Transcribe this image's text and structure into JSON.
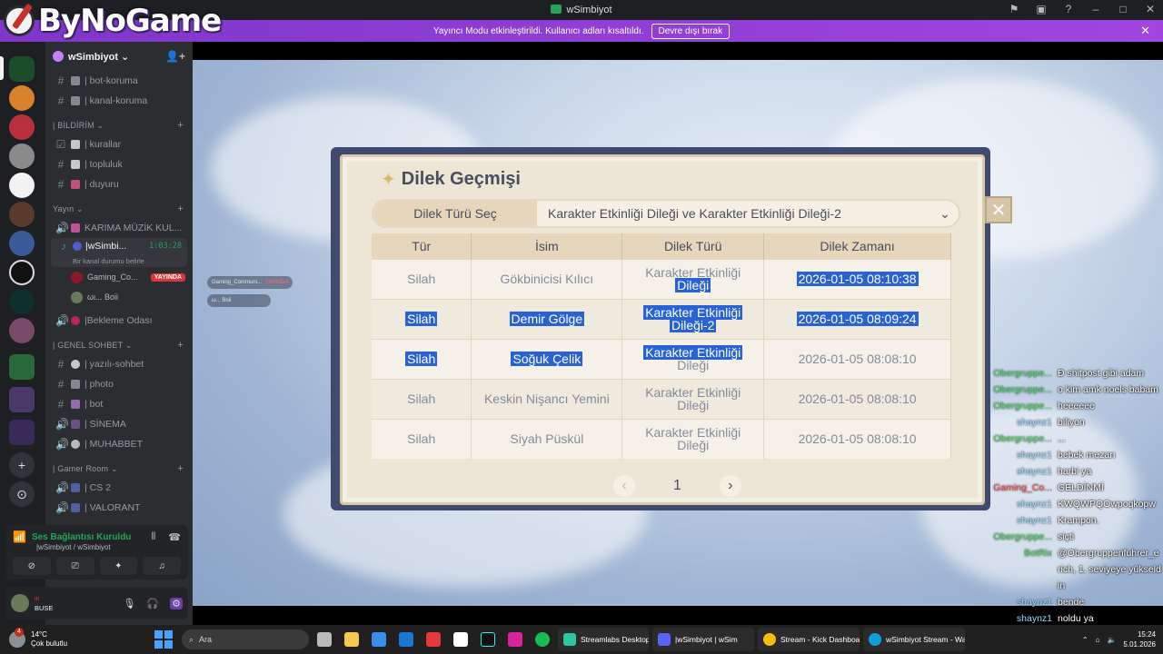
{
  "window": {
    "title": "wSimbiyot"
  },
  "brand": {
    "logo_text": "ByNoGame"
  },
  "banner": {
    "text": "Yayıncı Modu etkinleştirildi. Kullanıcı adları kısaltıldı.",
    "button": "Devre dışı bırak"
  },
  "server": {
    "name": "wSimbiyot ⌄"
  },
  "channels": {
    "top": [
      {
        "label": "| bot-koruma"
      },
      {
        "label": "| kanal-koruma"
      }
    ],
    "cat_bildirim": "| BİLDİRİM ⌄",
    "bildirim": [
      {
        "label": "| kurallar"
      },
      {
        "label": "| topluluk"
      },
      {
        "label": "| duyuru"
      }
    ],
    "cat_yayin": "Yayın ⌄",
    "yayin": [
      {
        "label": "KARIMA MÜZİK KUL..."
      }
    ],
    "active_voice": {
      "label": "|wSimbi...",
      "timer": "1:03:28",
      "status": "Bir kanal durumu belirle"
    },
    "voice_users": [
      {
        "name": "Gaming_Co...",
        "badge": "YAYINDA"
      },
      {
        "name": "ωι...  Boii"
      }
    ],
    "waiting": "|Bekleme Odası",
    "cat_genel": "| GENEL SOHBET ⌄",
    "genel": [
      {
        "label": "| yazılı-sohbet"
      },
      {
        "label": "| photo"
      },
      {
        "label": "| bot"
      },
      {
        "label": "| SİNEMA"
      },
      {
        "label": "| MUHABBET"
      }
    ],
    "cat_gamer": "| Gamer Room ⌄",
    "gamer": [
      {
        "label": "| CS 2"
      },
      {
        "label": "| VALORANT"
      }
    ]
  },
  "voice_panel": {
    "title": "Ses Bağlantısı Kuruldu",
    "sub": "|wSimbiyot / wSimbiyot"
  },
  "user_panel": {
    "name": "BUSE",
    "badge": "ιιι"
  },
  "stream_overlay": {
    "chip1": "Gaming_Communi...",
    "chip1_tag": "YAYINDA",
    "chip2": "ω...  Boii"
  },
  "wish": {
    "title": "Dilek Geçmişi",
    "select_label": "Dilek Türü Seç",
    "select_value": "Karakter Etkinliği Dileği ve Karakter Etkinliği Dileği-2",
    "headers": [
      "Tür",
      "İsim",
      "Dilek Türü",
      "Dilek Zamanı"
    ],
    "rows": [
      {
        "type": "Silah",
        "name": "Gökbinicisi Kılıcı",
        "wish1": "Karakter Etkinliği",
        "wish2": "Dileği",
        "time": "2026-01-05 08:10:38"
      },
      {
        "type": "Silah",
        "name": "Demir Gölge",
        "wish1": "Karakter Etkinliği",
        "wish2": "Dileği-2",
        "time": "2026-01-05 08:09:24"
      },
      {
        "type": "Silah",
        "name": "Soğuk Çelik",
        "wish1": "Karakter Etkinliği",
        "wish2": "Dileği",
        "time": "2026-01-05 08:08:10"
      },
      {
        "type": "Silah",
        "name": "Keskin Nişancı Yemini",
        "wish1": "Karakter Etkinliği",
        "wish2": "Dileği",
        "time": "2026-01-05 08:08:10"
      },
      {
        "type": "Silah",
        "name": "Siyah Püskül",
        "wish1": "Karakter Etkinliği",
        "wish2": "Dileği",
        "time": "2026-01-05 08:08:10"
      }
    ],
    "page": "1"
  },
  "chat": [
    {
      "user": "Obergruppe...",
      "text": "Đ shitpost gibi adam",
      "color": "#4cd964"
    },
    {
      "user": "Obergruppe...",
      "text": "o kim amk noels babam",
      "color": "#4cd964"
    },
    {
      "user": "Obergruppe...",
      "text": "heeeeee",
      "color": "#4cd964"
    },
    {
      "user": "shaynz1",
      "text": "biliyon",
      "color": "#9fd9ff"
    },
    {
      "user": "Obergruppe...",
      "text": "...",
      "color": "#4cd964"
    },
    {
      "user": "shaynz1",
      "text": "bebek mezarı",
      "color": "#9fd9ff"
    },
    {
      "user": "shaynz1",
      "text": "harbi ya",
      "color": "#9fd9ff"
    },
    {
      "user": "Gaming_Co...",
      "text": "GELDİNMİ",
      "color": "#ff4d4d"
    },
    {
      "user": "shaynz1",
      "text": "KWQWPQOwpoqkopw",
      "color": "#9fd9ff"
    },
    {
      "user": "shaynz1",
      "text": "Krampon.",
      "color": "#9fd9ff"
    },
    {
      "user": "Obergruppe...",
      "text": "siçti",
      "color": "#4cd964"
    },
    {
      "user": "BotRix",
      "text": "@Obergruppenfuhrer_erich, 1. seviyeye yükseldin",
      "color": "#4cd964"
    },
    {
      "user": "shaynz1",
      "text": "bende",
      "color": "#9fd9ff"
    },
    {
      "user": "shaynz1",
      "text": "noldu ya",
      "color": "#9fd9ff"
    }
  ],
  "taskbar": {
    "weather_temp": "14°C",
    "weather_desc": "Çok bulutlu",
    "weather_badge": "4",
    "search_placeholder": "Ara",
    "apps": [
      {
        "label": "Streamlabs Desktop"
      },
      {
        "label": "|wSimbiyot | wSim"
      },
      {
        "label": "Stream - Kick Dashboar"
      },
      {
        "label": "wSimbiyot Stream - Wa"
      }
    ],
    "time": "15:24",
    "date": "5.01.2026"
  }
}
